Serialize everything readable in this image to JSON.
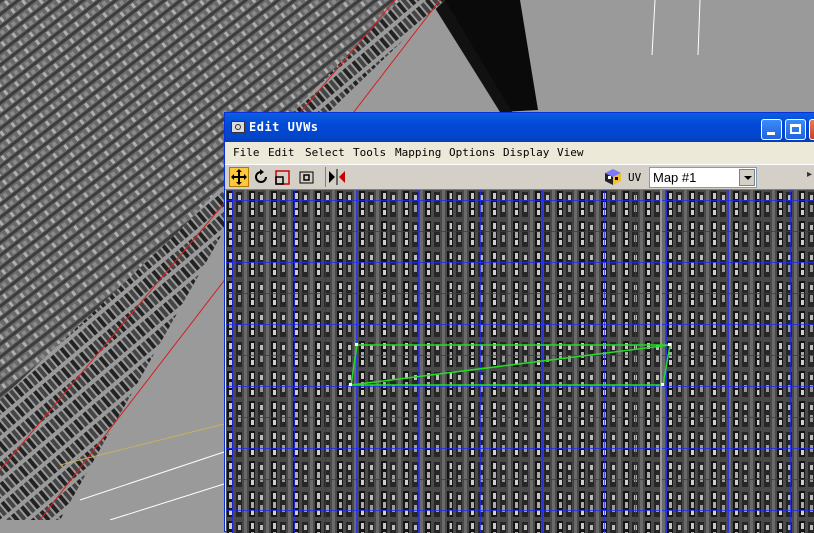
{
  "window": {
    "title": "Edit UVWs"
  },
  "menu": {
    "items": [
      "File",
      "Edit",
      "Select",
      "Tools",
      "Mapping",
      "Options",
      "Display",
      "View"
    ]
  },
  "toolbar": {
    "uv_label": "UV",
    "map_channel": "Map #1"
  },
  "icons": {
    "move": "move-icon",
    "rotate": "rotate-icon",
    "scale": "scale-icon",
    "freeform": "freeform-icon",
    "mirror": "mirror-icon",
    "checker": "checker-cube-icon"
  },
  "colors": {
    "uv_grid": "#1e28ff",
    "selected_face": "#22dd22",
    "title_bar": "#0349d8",
    "viewport_edge": "#d42020"
  }
}
